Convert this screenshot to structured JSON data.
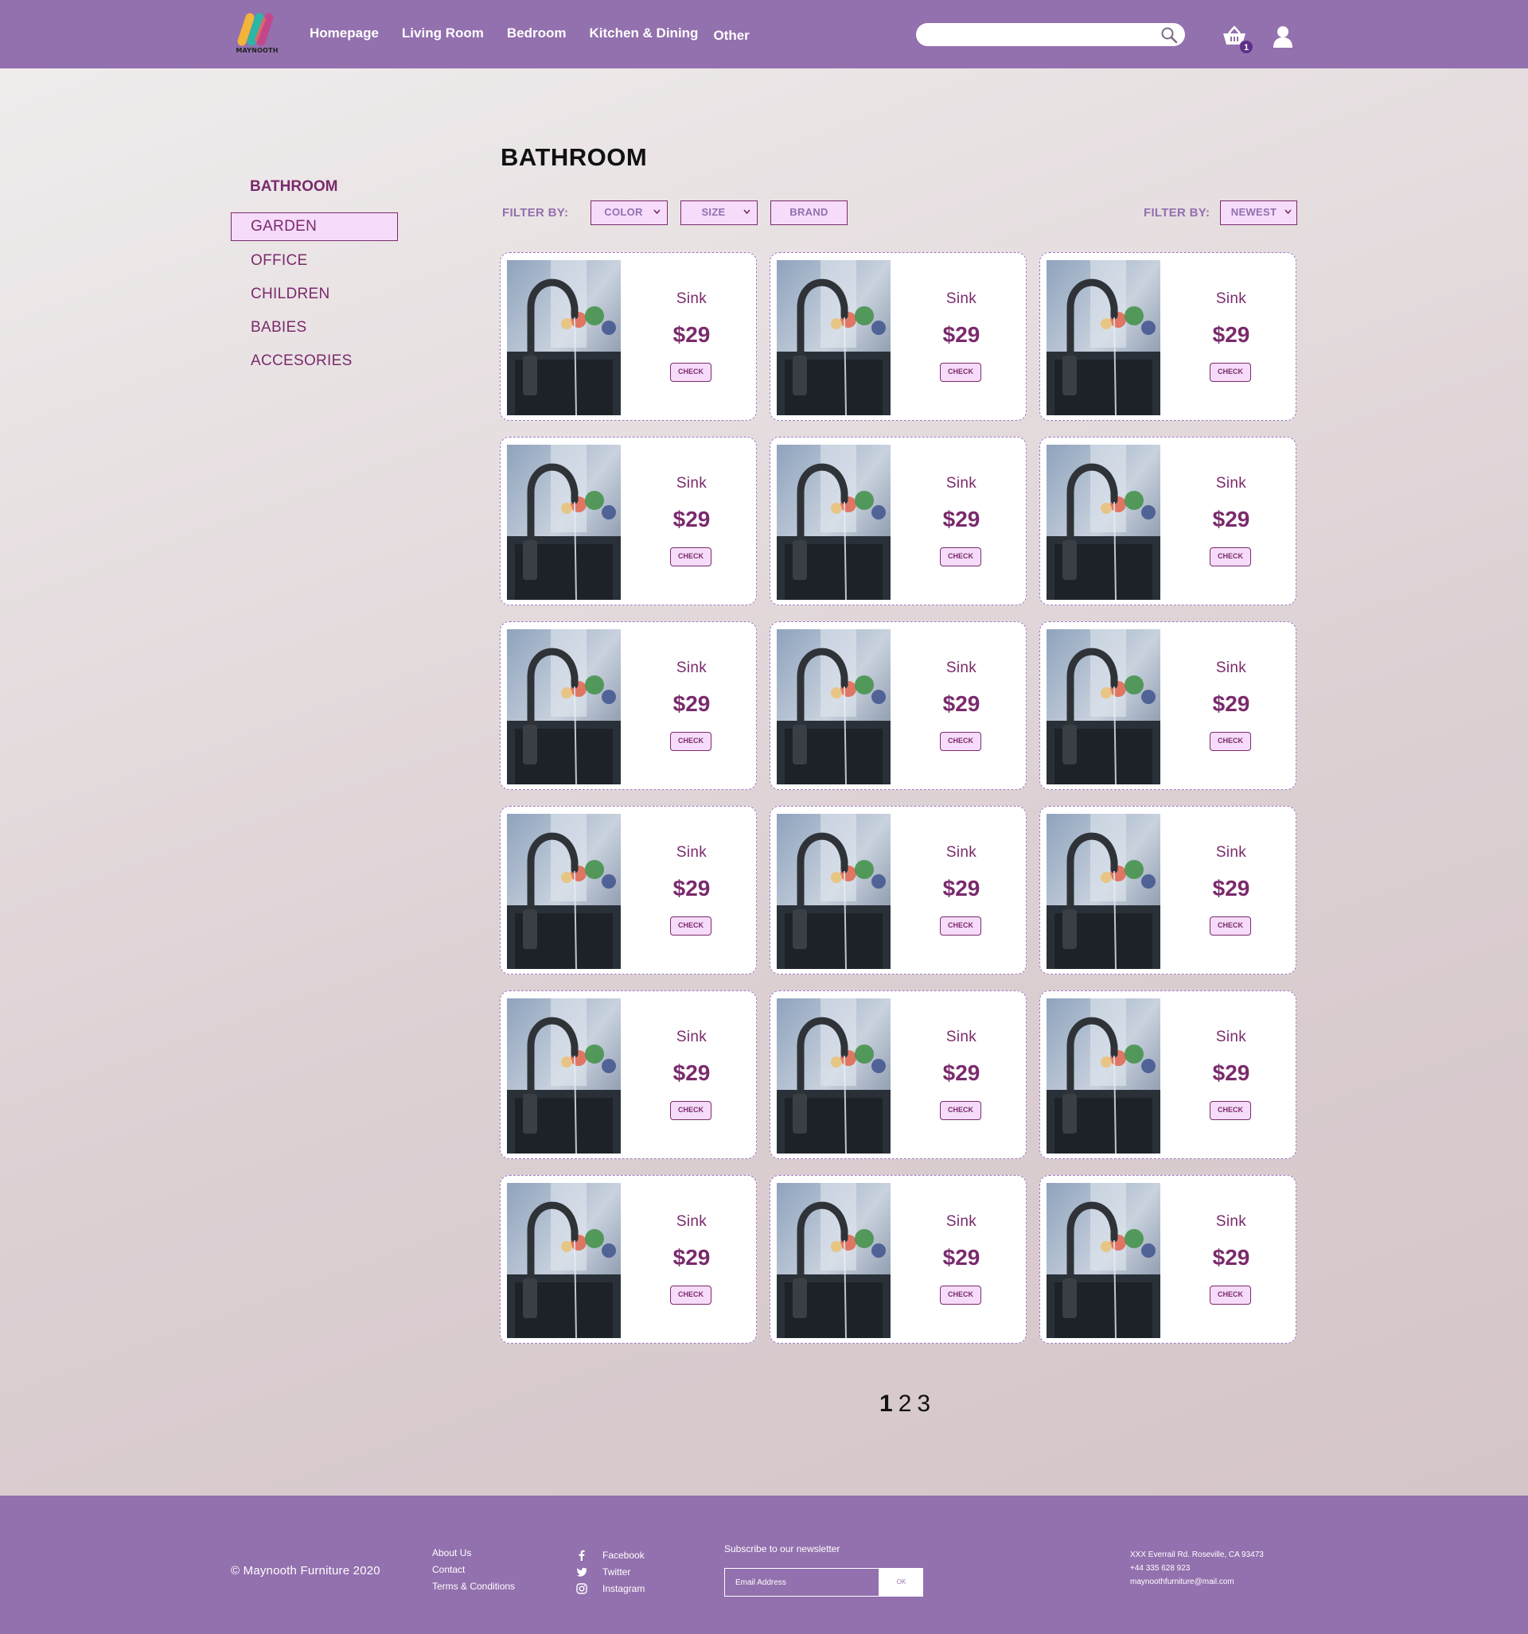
{
  "header": {
    "logo_text": "MAYNOOTH",
    "nav": [
      "Homepage",
      "Living Room",
      "Bedroom",
      "Kitchen & Dining",
      "Other"
    ],
    "search_placeholder": "",
    "cart_count": "1",
    "icons": {
      "search": "search-icon",
      "cart": "basket-icon",
      "user": "user-icon"
    }
  },
  "sidebar": {
    "title": "BATHROOM",
    "items": [
      {
        "label": "GARDEN",
        "active": true
      },
      {
        "label": "OFFICE",
        "active": false
      },
      {
        "label": "CHILDREN",
        "active": false
      },
      {
        "label": "BABIES",
        "active": false
      },
      {
        "label": "ACCESORIES",
        "active": false
      }
    ]
  },
  "main": {
    "title": "BATHROOM",
    "filter_label": "FILTER BY:",
    "filters": [
      "COLOR",
      "SIZE",
      "BRAND"
    ],
    "sort_label": "FILTER BY:",
    "sort_value": "NEWEST",
    "products": [
      {
        "name": "Sink",
        "price": "$29",
        "button": "CHECK"
      },
      {
        "name": "Sink",
        "price": "$29",
        "button": "CHECK"
      },
      {
        "name": "Sink",
        "price": "$29",
        "button": "CHECK"
      },
      {
        "name": "Sink",
        "price": "$29",
        "button": "CHECK"
      },
      {
        "name": "Sink",
        "price": "$29",
        "button": "CHECK"
      },
      {
        "name": "Sink",
        "price": "$29",
        "button": "CHECK"
      },
      {
        "name": "Sink",
        "price": "$29",
        "button": "CHECK"
      },
      {
        "name": "Sink",
        "price": "$29",
        "button": "CHECK"
      },
      {
        "name": "Sink",
        "price": "$29",
        "button": "CHECK"
      },
      {
        "name": "Sink",
        "price": "$29",
        "button": "CHECK"
      },
      {
        "name": "Sink",
        "price": "$29",
        "button": "CHECK"
      },
      {
        "name": "Sink",
        "price": "$29",
        "button": "CHECK"
      },
      {
        "name": "Sink",
        "price": "$29",
        "button": "CHECK"
      },
      {
        "name": "Sink",
        "price": "$29",
        "button": "CHECK"
      },
      {
        "name": "Sink",
        "price": "$29",
        "button": "CHECK"
      },
      {
        "name": "Sink",
        "price": "$29",
        "button": "CHECK"
      },
      {
        "name": "Sink",
        "price": "$29",
        "button": "CHECK"
      },
      {
        "name": "Sink",
        "price": "$29",
        "button": "CHECK"
      }
    ],
    "pages": [
      "1",
      "2",
      "3"
    ],
    "current_page": "1"
  },
  "footer": {
    "copyright": "© Maynooth Furniture 2020",
    "links": [
      "About Us",
      "Contact",
      "Terms & Conditions"
    ],
    "social": [
      {
        "label": "Facebook",
        "icon": "facebook-icon"
      },
      {
        "label": "Twitter",
        "icon": "twitter-icon"
      },
      {
        "label": "Instagram",
        "icon": "instagram-icon"
      }
    ],
    "newsletter_label": "Subscribe to our newsletter",
    "newsletter_placeholder": "Email Address",
    "newsletter_button": "OK",
    "address": "XXX Everrail Rd. Roseville, CA 93473",
    "phone": "+44 335 628 923",
    "email": "maynoothfurniture@mail.com"
  },
  "colors": {
    "brand_purple": "#9370ae",
    "text_plum": "#7a2a6c",
    "highlight_pink": "#f6dcfa"
  }
}
